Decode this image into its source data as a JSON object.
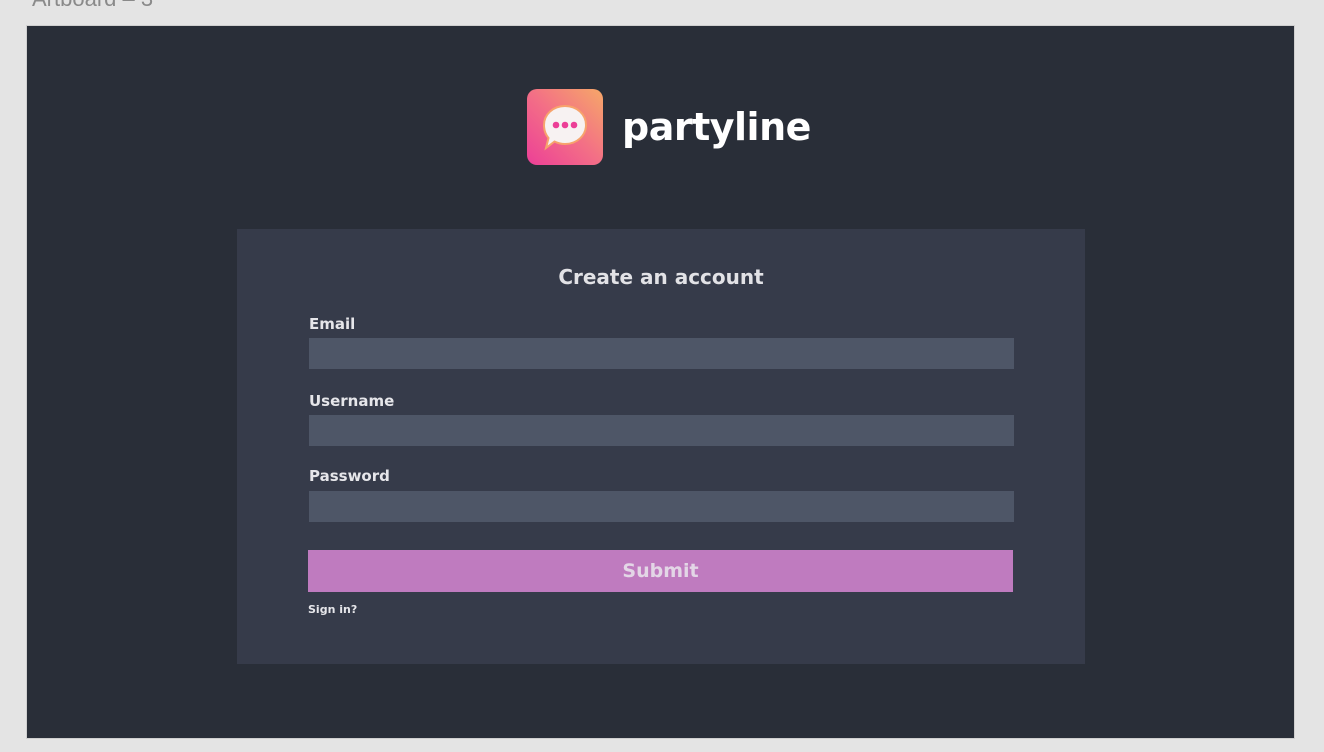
{
  "artboard": {
    "label": "Artboard – 3"
  },
  "brand": {
    "name": "partyline",
    "icon": "chat-bubble-icon"
  },
  "form": {
    "title": "Create an account",
    "fields": [
      {
        "label": "Email",
        "value": "",
        "placeholder": ""
      },
      {
        "label": "Username",
        "value": "",
        "placeholder": ""
      },
      {
        "label": "Password",
        "value": "",
        "placeholder": ""
      }
    ],
    "submit_label": "Submit",
    "signin_link": "Sign in?"
  },
  "colors": {
    "artboard_bg": "#292e38",
    "card_bg": "#363b4a",
    "input_bg": "#4e5667",
    "submit_bg": "#bf7bbf",
    "icon_gradient": [
      "#ec3f97",
      "#f6a868"
    ]
  }
}
